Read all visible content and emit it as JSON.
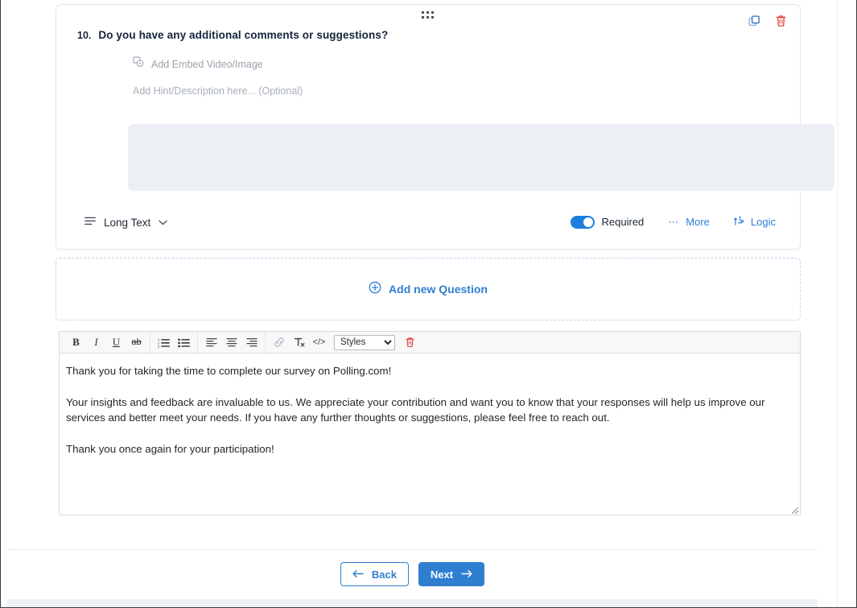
{
  "question": {
    "number": "10.",
    "title": "Do you have any additional comments or suggestions?",
    "embed_label": "Add Embed Video/Image",
    "hint_placeholder": "Add Hint/Description here... (Optional)",
    "answer_value": "",
    "type_label": "Long Text",
    "required_label": "Required",
    "required_on": true,
    "more_label": "More",
    "logic_label": "Logic",
    "copy_icon": "copy-icon",
    "delete_icon": "trash-icon",
    "drag_icon": "drag-handle-icon"
  },
  "add_question": {
    "label": "Add new Question",
    "icon": "plus-circle-icon"
  },
  "editor": {
    "toolbar": [
      {
        "name": "bold-button",
        "label": "B"
      },
      {
        "name": "italic-button",
        "label": "I"
      },
      {
        "name": "underline-button",
        "label": "U"
      },
      {
        "name": "strikethrough-button",
        "label": "ab"
      },
      {
        "name": "numbered-list-button",
        "label": "numbered-list-icon"
      },
      {
        "name": "bulleted-list-button",
        "label": "bulleted-list-icon"
      },
      {
        "name": "align-left-button",
        "label": "align-left-icon"
      },
      {
        "name": "align-center-button",
        "label": "align-center-icon"
      },
      {
        "name": "align-right-button",
        "label": "align-right-icon"
      },
      {
        "name": "link-button",
        "label": "link-icon"
      },
      {
        "name": "remove-format-button",
        "label": "Tx"
      },
      {
        "name": "source-code-button",
        "label": "</>"
      }
    ],
    "styles_selected": "Styles",
    "styles_options": [
      "Styles"
    ],
    "delete_icon": "trash-icon",
    "paragraphs": [
      "Thank you for taking the time to complete our survey on Polling.com!",
      "Your insights and feedback are invaluable to us.  We appreciate your contribution and want you to know that your responses will help us improve our services and better meet your needs.  If you have any further thoughts or suggestions, please feel free to reach out.",
      "Thank you once again for your participation!"
    ]
  },
  "footer": {
    "back_label": "Back",
    "next_label": "Next",
    "back_icon": "arrow-left-icon",
    "next_icon": "arrow-right-icon"
  },
  "colors": {
    "accent_blue": "#2f7fd1",
    "toggle_blue": "#1d7fdd",
    "danger_red": "#e8423a",
    "answer_box": "#eceff4",
    "card_border": "#e3e9ef"
  }
}
